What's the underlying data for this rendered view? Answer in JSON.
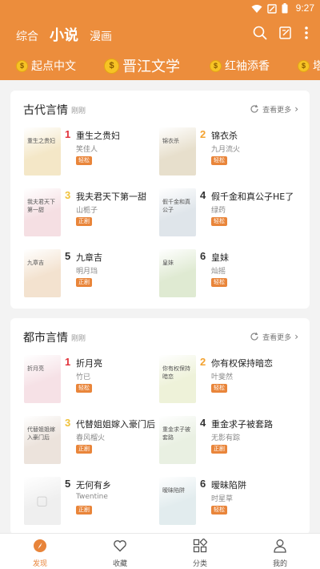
{
  "status": {
    "time": "9:27"
  },
  "header": {
    "tabs": [
      {
        "label": "综合"
      },
      {
        "label": "小说"
      },
      {
        "label": "漫画"
      }
    ],
    "active_tab": 1
  },
  "sources": [
    {
      "label": "起点中文"
    },
    {
      "label": "晋江文学"
    },
    {
      "label": "红袖添香"
    },
    {
      "label": "塔"
    }
  ],
  "sections": [
    {
      "title": "古代言情",
      "subtitle": "刚刚",
      "more": "查看更多",
      "books": [
        {
          "rank": "1",
          "title": "重生之贵妇",
          "author": "笑佳人",
          "tag": "轻松",
          "cover_text": "重生之贵妇",
          "cover_color": "#f4e7c7"
        },
        {
          "rank": "2",
          "title": "锦衣杀",
          "author": "九月流火",
          "tag": "轻松",
          "cover_text": "锦衣杀",
          "cover_color": "#e7dfcc"
        },
        {
          "rank": "3",
          "title": "我夫君天下第一甜",
          "author": "山栀子",
          "tag": "正剧",
          "cover_text": "我夫君天下第一甜",
          "cover_color": "#f5dfe3"
        },
        {
          "rank": "4",
          "title": "假千金和真公子HE了",
          "author": "绿药",
          "tag": "轻松",
          "cover_text": "假千金和真公子",
          "cover_color": "#dfe5ea"
        },
        {
          "rank": "5",
          "title": "九章吉",
          "author": "明月珰",
          "tag": "正剧",
          "cover_text": "九章吉",
          "cover_color": "#f3e2cf"
        },
        {
          "rank": "6",
          "title": "皇妹",
          "author": "灿摇",
          "tag": "轻松",
          "cover_text": "皇妹",
          "cover_color": "#dfead2"
        }
      ]
    },
    {
      "title": "都市言情",
      "subtitle": "刚刚",
      "more": "查看更多",
      "books": [
        {
          "rank": "1",
          "title": "折月亮",
          "author": "竹已",
          "tag": "轻松",
          "cover_text": "折月亮",
          "cover_color": "#f6e1e6"
        },
        {
          "rank": "2",
          "title": "你有权保持暗恋",
          "author": "叶斐然",
          "tag": "轻松",
          "cover_text": "你有权保持暗恋",
          "cover_color": "#eef2d9"
        },
        {
          "rank": "3",
          "title": "代替姐姐嫁入豪门后",
          "author": "春风榴火",
          "tag": "正剧",
          "cover_text": "代替姐姐嫁入豪门后",
          "cover_color": "#ece3dc"
        },
        {
          "rank": "4",
          "title": "重金求子被套路",
          "author": "无影有踪",
          "tag": "正剧",
          "cover_text": "重金求子被套路",
          "cover_color": "#e9f0e2"
        },
        {
          "rank": "5",
          "title": "无何有乡",
          "author": "Twentine",
          "tag": "正剧",
          "cover_text": "",
          "cover_color": "#efefef"
        },
        {
          "rank": "6",
          "title": "暧昧陷阱",
          "author": "时星草",
          "tag": "轻松",
          "cover_text": "暧昧陷阱",
          "cover_color": "#e2ecee"
        }
      ]
    }
  ],
  "colors": {
    "brand": "#ec8d3c",
    "rank_1": "#e2333b",
    "rank_2": "#f3a230",
    "rank_3": "#f0c23a",
    "rank_other": "#333333"
  },
  "bottom_nav": [
    {
      "label": "发现",
      "icon": "discover-icon"
    },
    {
      "label": "收藏",
      "icon": "heart-icon"
    },
    {
      "label": "分类",
      "icon": "category-icon"
    },
    {
      "label": "我的",
      "icon": "user-icon"
    }
  ]
}
